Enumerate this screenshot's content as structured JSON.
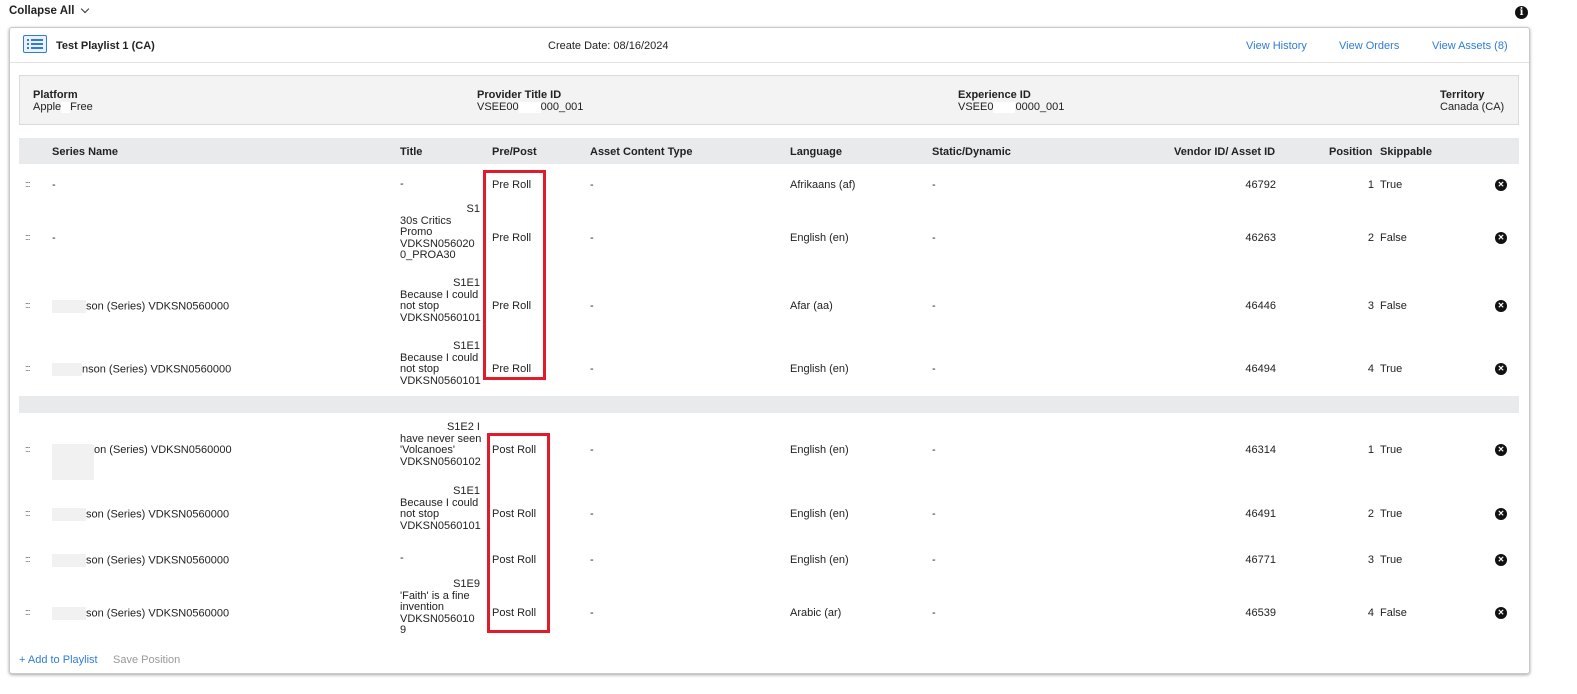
{
  "toolbar": {
    "collapse_all": "Collapse All"
  },
  "header": {
    "playlist_title": "Test Playlist 1 (CA)",
    "create_date": "Create Date: 08/16/2024",
    "view_history": "View History",
    "view_orders": "View Orders",
    "view_assets": "View Assets (8)"
  },
  "meta": {
    "platform_label": "Platform",
    "platform_value_a": "Apple",
    "platform_value_b": "Free",
    "provider_label": "Provider Title ID",
    "provider_value_a": "VSEE00",
    "provider_value_b": "000_001",
    "experience_label": "Experience ID",
    "experience_value_a": "VSEE0",
    "experience_value_b": "0000_001",
    "territory_label": "Territory",
    "territory_value": "Canada (CA)"
  },
  "columns": {
    "series_name": "Series Name",
    "title": "Title",
    "pre_post": "Pre/Post",
    "asset_content_type": "Asset Content Type",
    "language": "Language",
    "static_dynamic": "Static/Dynamic",
    "vendor_asset_id": "Vendor ID/ Asset ID",
    "position": "Position",
    "skippable": "Skippable"
  },
  "rows": [
    {
      "series": "-",
      "title_lines": [
        "-"
      ],
      "prepost": "Pre Roll",
      "act": "-",
      "language": "Afrikaans (af)",
      "sd": "-",
      "asset_id": "46792",
      "position": "1",
      "skippable": "True"
    },
    {
      "series": "-",
      "title_lines": [
        "S1",
        "30s Critics",
        "Promo",
        "VDKSN056020",
        "0_PROA30"
      ],
      "prepost": "Pre Roll",
      "act": "-",
      "language": "English (en)",
      "sd": "-",
      "asset_id": "46263",
      "position": "2",
      "skippable": "False"
    },
    {
      "series": "son (Series) VDKSN0560000",
      "title_lines": [
        "S1E1",
        "Because I could",
        "not stop",
        "VDKSN0560101"
      ],
      "prepost": "Pre Roll",
      "act": "-",
      "language": "Afar (aa)",
      "sd": "-",
      "asset_id": "46446",
      "position": "3",
      "skippable": "False"
    },
    {
      "series": "nson (Series) VDKSN0560000",
      "title_lines": [
        "S1E1",
        "Because I could",
        "not stop",
        "VDKSN0560101"
      ],
      "prepost": "Pre Roll",
      "act": "-",
      "language": "English (en)",
      "sd": "-",
      "asset_id": "46494",
      "position": "4",
      "skippable": "True"
    },
    {
      "series": "on (Series) VDKSN0560000",
      "title_lines": [
        "S1E2 I",
        "have never seen",
        "'Volcanoes'",
        "VDKSN0560102"
      ],
      "prepost": "Post Roll",
      "act": "-",
      "language": "English (en)",
      "sd": "-",
      "asset_id": "46314",
      "position": "1",
      "skippable": "True"
    },
    {
      "series": "son (Series) VDKSN0560000",
      "title_lines": [
        "S1E1",
        "Because I could",
        "not stop",
        "VDKSN0560101"
      ],
      "prepost": "Post Roll",
      "act": "-",
      "language": "English (en)",
      "sd": "-",
      "asset_id": "46491",
      "position": "2",
      "skippable": "True"
    },
    {
      "series": "son (Series) VDKSN0560000",
      "title_lines": [
        "-"
      ],
      "prepost": "Post Roll",
      "act": "-",
      "language": "English (en)",
      "sd": "-",
      "asset_id": "46771",
      "position": "3",
      "skippable": "True"
    },
    {
      "series": "son (Series) VDKSN0560000",
      "title_lines": [
        "S1E9",
        "'Faith' is a fine",
        "invention",
        "VDKSN056010",
        "9"
      ],
      "prepost": "Post Roll",
      "act": "-",
      "language": "Arabic (ar)",
      "sd": "-",
      "asset_id": "46539",
      "position": "4",
      "skippable": "False"
    }
  ],
  "footer": {
    "add_to_playlist": "+ Add to Playlist",
    "save_position": "Save Position"
  },
  "icons": {
    "info": "info-icon",
    "remove": "remove-circle-icon",
    "playlist": "list-icon",
    "drag": "drag-handle-icon",
    "collapse": "chevron-down-icon"
  },
  "colors": {
    "link": "#2f7bd6",
    "highlight": "#e21b2b",
    "header_bg": "#e9eaec"
  }
}
